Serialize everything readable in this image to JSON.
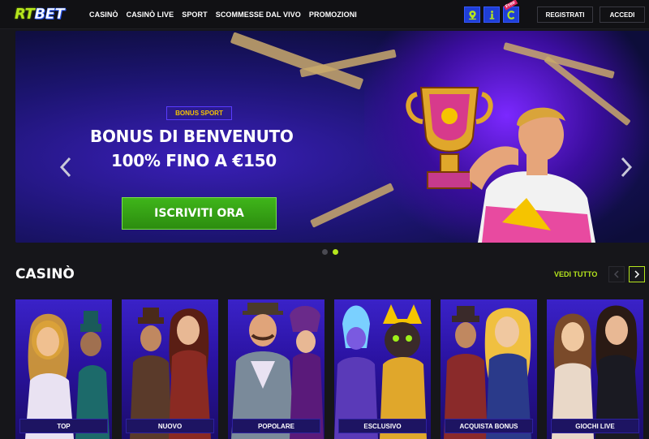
{
  "header": {
    "logo_rt": "RT",
    "logo_bet": "BET",
    "nav": [
      "CASINÒ",
      "CASINÒ LIVE",
      "SPORT",
      "SCOMMESSE DAL VIVO",
      "PROMOZIONI"
    ],
    "icons": [
      "location-icon",
      "info-icon",
      "free-c-icon"
    ],
    "free_tag": "Free",
    "register_label": "REGISTRATI",
    "login_label": "ACCEDI"
  },
  "hero": {
    "badge": "BONUS SPORT",
    "line1": "BONUS DI BENVENUTO",
    "line2": "100% FINO A €150",
    "cta": "ISCRIVITI ORA",
    "slides": 2,
    "active_slide": 2
  },
  "casino": {
    "title": "CASINÒ",
    "see_all": "VEDI TUTTO",
    "cards": [
      {
        "label": "TOP"
      },
      {
        "label": "NUOVO"
      },
      {
        "label": "POPOLARE"
      },
      {
        "label": "ESCLUSIVO"
      },
      {
        "label": "ACQUISTA BONUS"
      },
      {
        "label": "GIOCHI LIVE"
      }
    ]
  },
  "colors": {
    "accent": "#b5e61d",
    "cta_green": "#3fb51a",
    "badge_gold": "#f5c400",
    "card_purple": "#3a22c8",
    "header_bg": "#111114"
  }
}
